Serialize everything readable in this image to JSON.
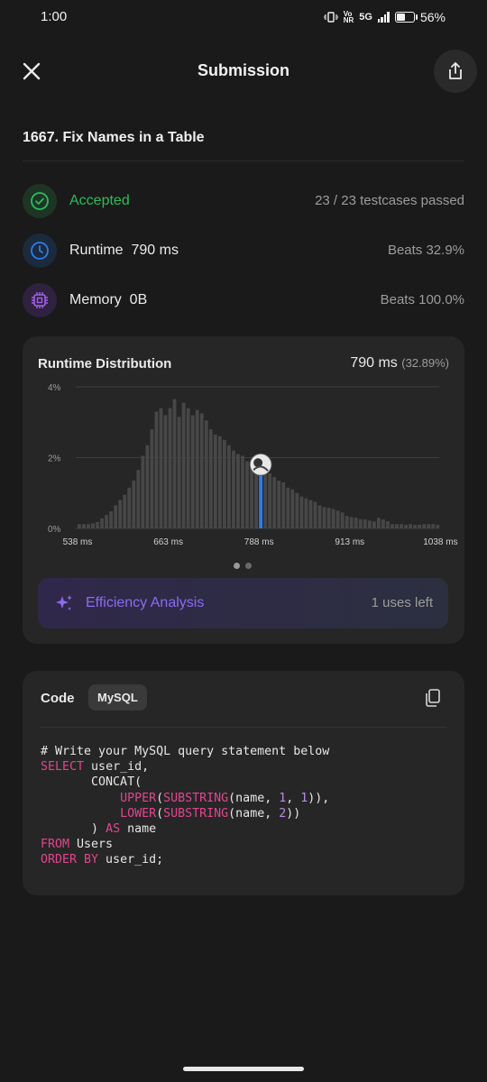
{
  "status_bar": {
    "time": "1:00",
    "network_top": "Vo",
    "network_bottom": "NR",
    "network_type": "5G",
    "battery": "56%",
    "battery_level": 0.56
  },
  "header": {
    "title": "Submission"
  },
  "problem": {
    "title": "1667. Fix Names in a Table"
  },
  "result": {
    "status": "Accepted",
    "testcases": "23 / 23 testcases passed"
  },
  "runtime": {
    "label": "Runtime",
    "value": "790 ms",
    "beats": "Beats 32.9%"
  },
  "memory": {
    "label": "Memory",
    "value": "0B",
    "beats": "Beats 100.0%"
  },
  "distribution": {
    "title": "Runtime Distribution",
    "value": "790 ms",
    "percent": "(32.89%)",
    "efficiency_label": "Efficiency Analysis",
    "uses_left": "1 uses left"
  },
  "chart_data": {
    "type": "bar",
    "x_ticks": [
      "538 ms",
      "663 ms",
      "788 ms",
      "913 ms",
      "1038 ms"
    ],
    "x_tick_values": [
      538,
      663,
      788,
      913,
      1038
    ],
    "y_ticks": [
      "4%",
      "2%",
      "0%"
    ],
    "y_tick_values": [
      4,
      2,
      0
    ],
    "ylim": [
      0,
      4
    ],
    "x_start": 538,
    "bin_width_ms": 6.25,
    "highlight_x": 788,
    "values": [
      0.12,
      0.12,
      0.12,
      0.14,
      0.18,
      0.28,
      0.38,
      0.48,
      0.65,
      0.8,
      0.95,
      1.15,
      1.35,
      1.65,
      2.05,
      2.35,
      2.8,
      3.3,
      3.4,
      3.2,
      3.4,
      3.65,
      3.15,
      3.55,
      3.4,
      3.2,
      3.35,
      3.25,
      3.05,
      2.8,
      2.65,
      2.6,
      2.5,
      2.35,
      2.2,
      2.1,
      2.05,
      1.9,
      1.85,
      1.75,
      1.65,
      1.6,
      1.55,
      1.45,
      1.35,
      1.3,
      1.15,
      1.1,
      1.0,
      0.9,
      0.85,
      0.8,
      0.75,
      0.65,
      0.6,
      0.58,
      0.55,
      0.5,
      0.45,
      0.35,
      0.32,
      0.3,
      0.26,
      0.25,
      0.22,
      0.2,
      0.3,
      0.25,
      0.2,
      0.12,
      0.12,
      0.12,
      0.1,
      0.12,
      0.1,
      0.1,
      0.12,
      0.12,
      0.12,
      0.1
    ]
  },
  "code": {
    "label": "Code",
    "language": "MySQL",
    "lines": [
      [
        {
          "t": "# Write your MySQL query statement below",
          "c": ""
        }
      ],
      [
        {
          "t": "SELECT",
          "c": "kw"
        },
        {
          "t": " user_id,",
          "c": ""
        }
      ],
      [
        {
          "t": "       CONCAT(",
          "c": ""
        }
      ],
      [
        {
          "t": "           ",
          "c": ""
        },
        {
          "t": "UPPER",
          "c": "kw"
        },
        {
          "t": "(",
          "c": ""
        },
        {
          "t": "SUBSTRING",
          "c": "kw"
        },
        {
          "t": "(name, ",
          "c": ""
        },
        {
          "t": "1",
          "c": "num"
        },
        {
          "t": ", ",
          "c": ""
        },
        {
          "t": "1",
          "c": "num"
        },
        {
          "t": ")),",
          "c": ""
        }
      ],
      [
        {
          "t": "           ",
          "c": ""
        },
        {
          "t": "LOWER",
          "c": "kw"
        },
        {
          "t": "(",
          "c": ""
        },
        {
          "t": "SUBSTRING",
          "c": "kw"
        },
        {
          "t": "(name, ",
          "c": ""
        },
        {
          "t": "2",
          "c": "num"
        },
        {
          "t": "))",
          "c": ""
        }
      ],
      [
        {
          "t": "       ) ",
          "c": ""
        },
        {
          "t": "AS",
          "c": "kw"
        },
        {
          "t": " name",
          "c": ""
        }
      ],
      [
        {
          "t": "FROM",
          "c": "kw"
        },
        {
          "t": " Users",
          "c": ""
        }
      ],
      [
        {
          "t": "ORDER BY",
          "c": "kw"
        },
        {
          "t": " user_id;",
          "c": ""
        }
      ]
    ]
  },
  "colors": {
    "accepted": "#2cbb5d",
    "runtime_accent": "#2b7de9",
    "memory_accent": "#a25ee8",
    "efficiency": "#8a6cf0",
    "keyword": "#e0468f",
    "number": "#b98be8",
    "bar": "#474747",
    "highlight_bar": "#2b7de9"
  }
}
